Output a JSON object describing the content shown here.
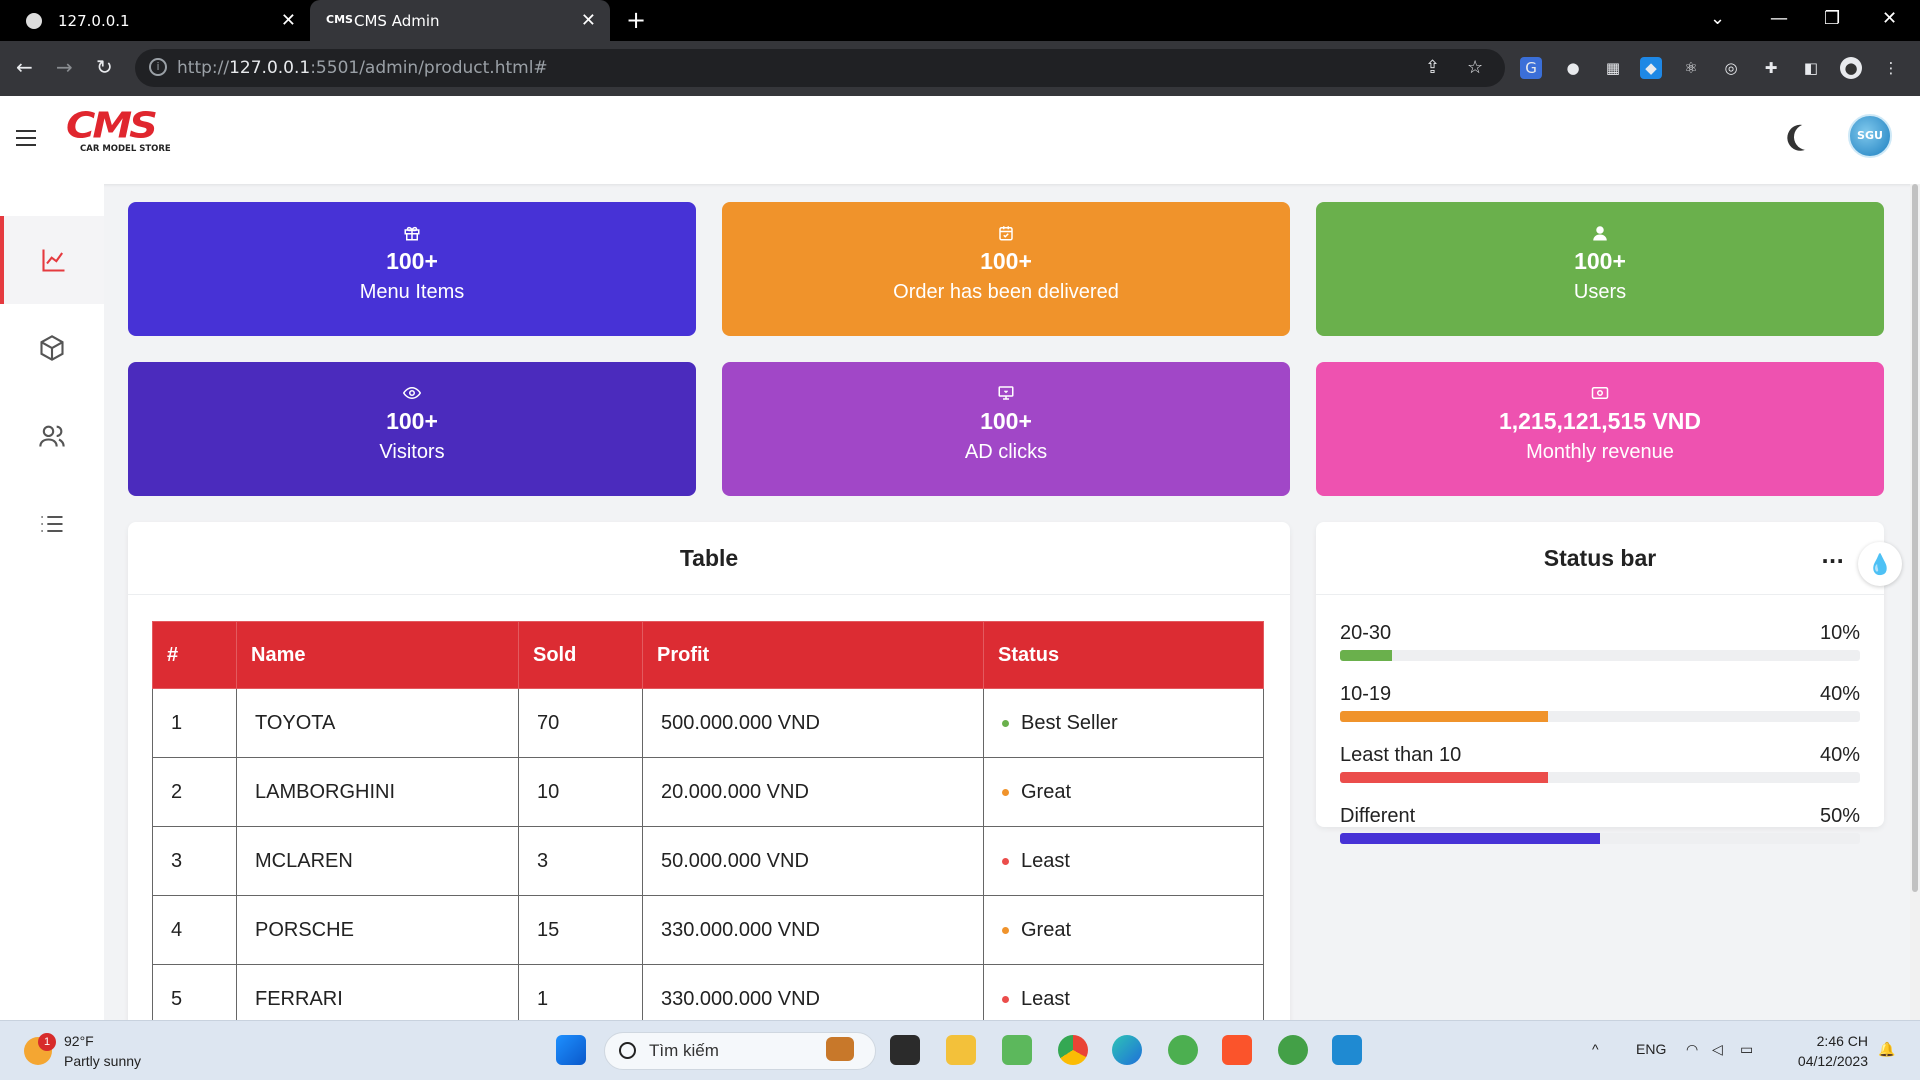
{
  "browser": {
    "tabs": [
      {
        "title": "127.0.0.1"
      },
      {
        "title": "CMS Admin"
      }
    ],
    "url_prefix": "http://",
    "url_host": "127.0.0.1",
    "url_rest": ":5501/admin/product.html#"
  },
  "header": {
    "logo_text": "CMS",
    "logo_sub": "CAR MODEL STORE",
    "avatar_text": "SGU"
  },
  "cards": [
    {
      "value": "100+",
      "label": "Menu Items",
      "icon": "gift-icon",
      "color": "#4732d6"
    },
    {
      "value": "100+",
      "label": "Order has been delivered",
      "icon": "calendar-check-icon",
      "color": "#f0932b"
    },
    {
      "value": "100+",
      "label": "Users",
      "icon": "user-icon",
      "color": "#6ab04c"
    },
    {
      "value": "100+",
      "label": "Visitors",
      "icon": "eye-icon",
      "color": "#4b2bbd"
    },
    {
      "value": "100+",
      "label": "AD clicks",
      "icon": "monitor-icon",
      "color": "#a147c7"
    },
    {
      "value": "1,215,121,515 VND",
      "label": "Monthly revenue",
      "icon": "money-icon",
      "color": "#ee52b0"
    }
  ],
  "table": {
    "title": "Table",
    "headers": [
      "#",
      "Name",
      "Sold",
      "Profit",
      "Status"
    ],
    "rows": [
      {
        "id": "1",
        "name": "TOYOTA",
        "sold": "70",
        "profit": "500.000.000 VND",
        "status": "Best Seller",
        "status_color": "#6ab04c"
      },
      {
        "id": "2",
        "name": "LAMBORGHINI",
        "sold": "10",
        "profit": "20.000.000 VND",
        "status": "Great",
        "status_color": "#f0932b"
      },
      {
        "id": "3",
        "name": "MCLAREN",
        "sold": "3",
        "profit": "50.000.000 VND",
        "status": "Least",
        "status_color": "#eb4d4b"
      },
      {
        "id": "4",
        "name": "PORSCHE",
        "sold": "15",
        "profit": "330.000.000 VND",
        "status": "Great",
        "status_color": "#f0932b"
      },
      {
        "id": "5",
        "name": "FERRARI",
        "sold": "1",
        "profit": "330.000.000 VND",
        "status": "Least",
        "status_color": "#eb4d4b"
      }
    ]
  },
  "status_bar": {
    "title": "Status bar",
    "more": "...",
    "items": [
      {
        "label": "20-30",
        "percent_text": "10%",
        "percent": 10,
        "color": "#6ab04c"
      },
      {
        "label": "10-19",
        "percent_text": "40%",
        "percent": 40,
        "color": "#f0932b"
      },
      {
        "label": "Least than 10",
        "percent_text": "40%",
        "percent": 40,
        "color": "#eb4d4b"
      },
      {
        "label": "Different",
        "percent_text": "50%",
        "percent": 50,
        "color": "#4732d6"
      }
    ]
  },
  "taskbar": {
    "weather_temp": "92°F",
    "weather_desc": "Partly sunny",
    "weather_badge": "1",
    "search_placeholder": "Tìm kiếm",
    "lang": "ENG",
    "time": "2:46 CH",
    "date": "04/12/2023"
  }
}
